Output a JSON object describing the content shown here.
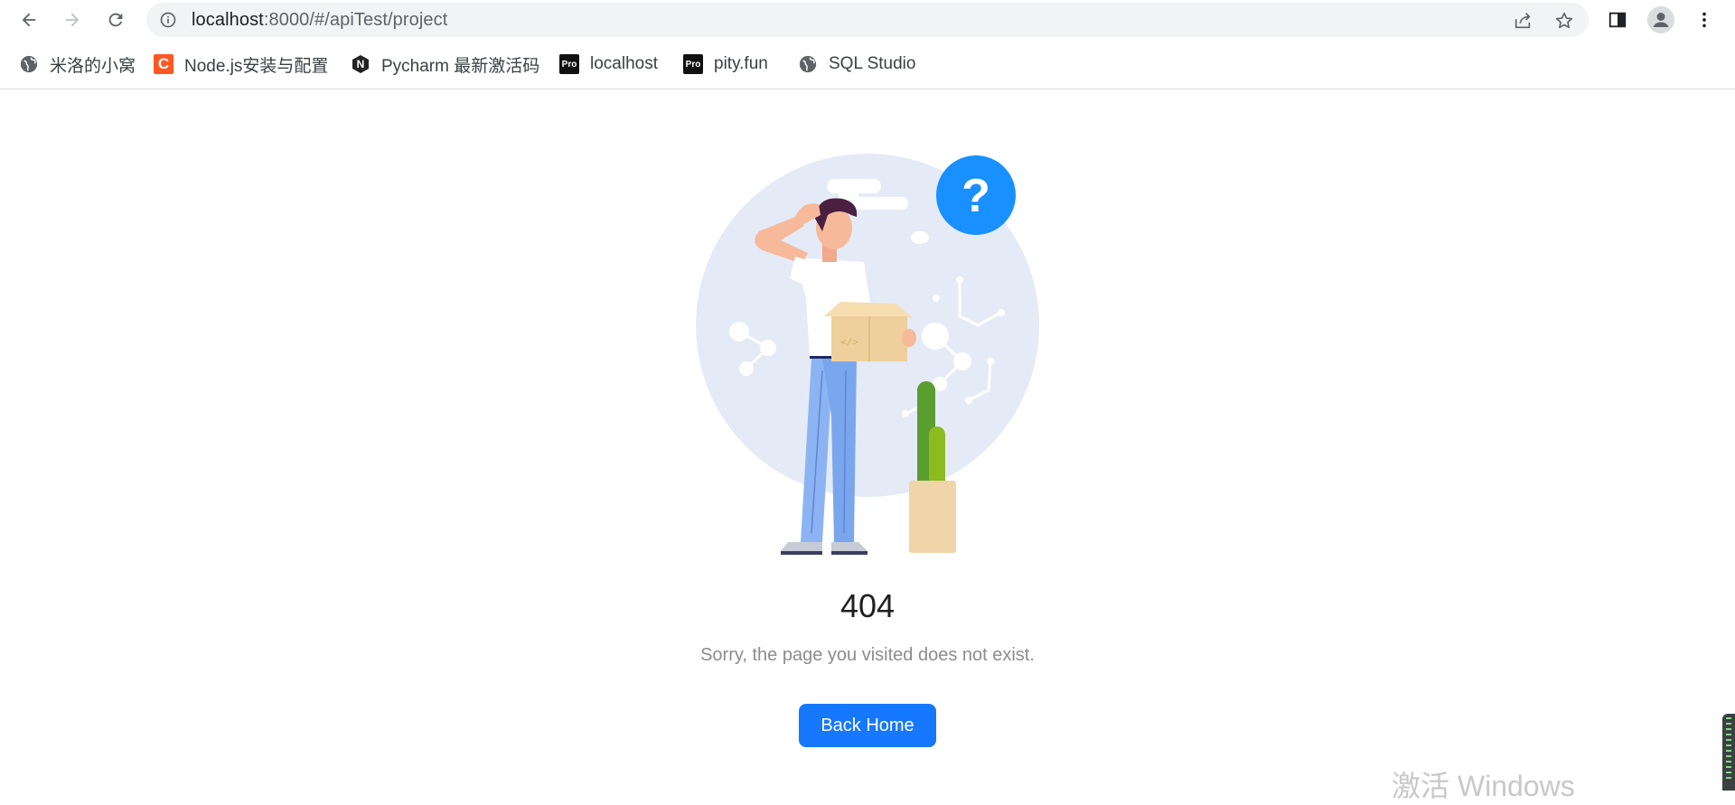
{
  "browser": {
    "url_host": "localhost",
    "url_path": ":8000/#/apiTest/project"
  },
  "bookmarks": [
    {
      "label": "米洛的小窝",
      "icon": "globe-icon"
    },
    {
      "label": "Node.js安装与配置",
      "icon": "c-logo-icon"
    },
    {
      "label": "Pycharm 最新激活码",
      "icon": "n-logo-icon"
    },
    {
      "label": "localhost",
      "icon": "pro-logo-icon",
      "icon_text": "Pro"
    },
    {
      "label": "pity.fun",
      "icon": "pro-logo-icon",
      "icon_text": "Pro"
    },
    {
      "label": "SQL Studio",
      "icon": "globe-icon"
    }
  ],
  "result": {
    "title": "404",
    "subtitle": "Sorry, the page you visited does not exist.",
    "button_label": "Back Home"
  },
  "watermark": "激活 Windows",
  "colors": {
    "primary": "#1677ff",
    "illustration_circle": "#e4ebf7",
    "question_badge": "#1890ff"
  }
}
